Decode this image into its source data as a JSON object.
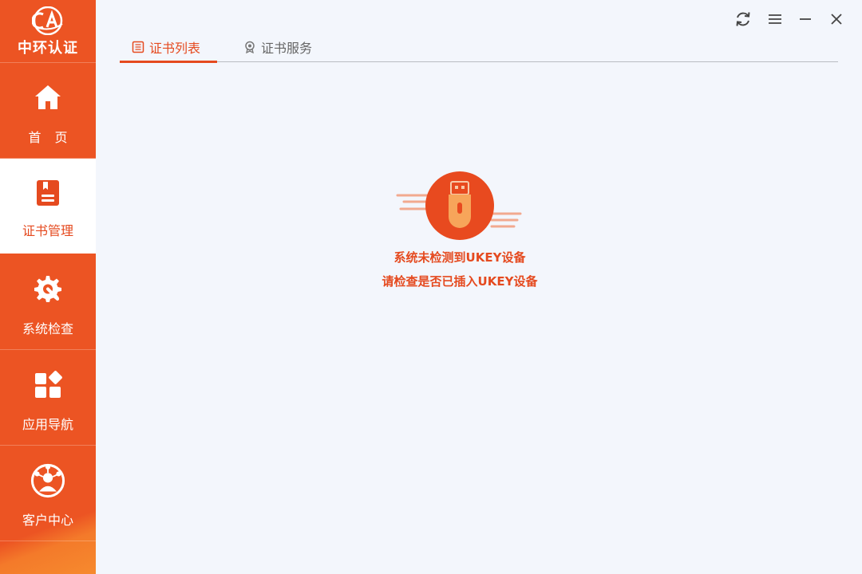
{
  "app": {
    "logo_text": "中环认证"
  },
  "sidebar": {
    "items": [
      {
        "label": "首 页",
        "icon": "home-icon",
        "active": false
      },
      {
        "label": "证书管理",
        "icon": "certificate-icon",
        "active": true
      },
      {
        "label": "系统检查",
        "icon": "gear-wrench-icon",
        "active": false
      },
      {
        "label": "应用导航",
        "icon": "apps-grid-icon",
        "active": false
      },
      {
        "label": "客户中心",
        "icon": "user-network-icon",
        "active": false
      }
    ]
  },
  "window_controls": [
    "refresh-icon",
    "menu-icon",
    "minimize-icon",
    "close-icon"
  ],
  "tabs": [
    {
      "label": "证书列表",
      "icon": "list-icon",
      "active": true
    },
    {
      "label": "证书服务",
      "icon": "badge-icon",
      "active": false
    }
  ],
  "empty_state": {
    "icon": "usb-key-icon",
    "line1": "系统未检测到UKEY设备",
    "line2": "请检查是否已插入UKEY设备"
  },
  "colors": {
    "accent": "#e54a1f",
    "sidebar": "#ec5423",
    "background": "#f3f6fc"
  }
}
